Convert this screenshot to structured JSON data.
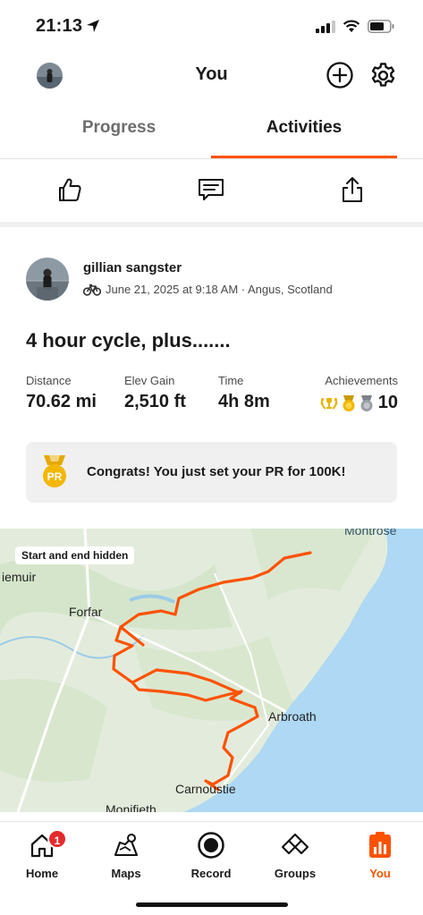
{
  "status_bar": {
    "time": "21:13"
  },
  "header": {
    "title": "You"
  },
  "tabs": [
    {
      "label": "Progress",
      "active": false
    },
    {
      "label": "Activities",
      "active": true
    }
  ],
  "activity": {
    "athlete_name": "gillian sangster",
    "meta": "June 21, 2025 at 9:18 AM · Angus, Scotland",
    "title": "4 hour cycle, plus.......",
    "stats": [
      {
        "label": "Distance",
        "value": "70.62 mi"
      },
      {
        "label": "Elev Gain",
        "value": "2,510 ft"
      },
      {
        "label": "Time",
        "value": "4h 8m"
      }
    ],
    "achievements": {
      "label": "Achievements",
      "count": "10"
    },
    "pr_banner": {
      "badge": "PR",
      "text": "Congrats! You just set your PR for 100K!"
    }
  },
  "map": {
    "chip": "Start and end hidden",
    "places": [
      "Forfar",
      "Arbroath",
      "Carnoustie",
      "Montrose",
      "iemuir",
      "Monifieth"
    ]
  },
  "tabbar": {
    "items": [
      {
        "label": "Home",
        "badge": "1"
      },
      {
        "label": "Maps"
      },
      {
        "label": "Record"
      },
      {
        "label": "Groups"
      },
      {
        "label": "You",
        "active": true
      }
    ]
  },
  "colors": {
    "accent": "#fc5200",
    "route": "#fc5200",
    "sea": "#aed8f3",
    "land": "#e3ecdc",
    "badge": "#e32b2b"
  }
}
